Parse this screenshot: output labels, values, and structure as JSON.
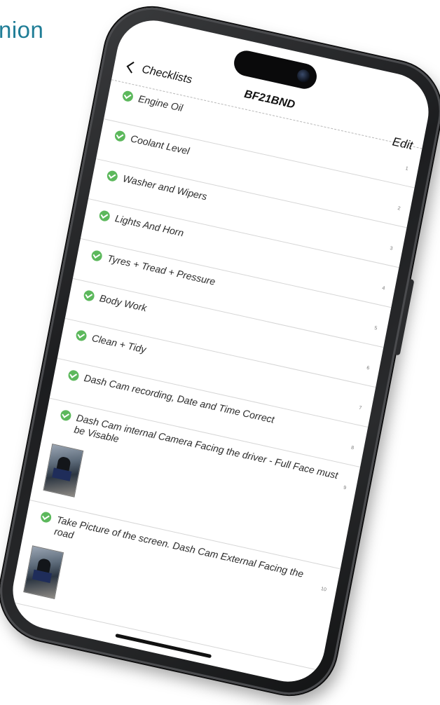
{
  "brand": {
    "fragment": "nion",
    "color": "#1f7d96"
  },
  "nav": {
    "back_label": "Checklists",
    "title": "BF21BND",
    "edit_label": "Edit"
  },
  "checklist": [
    {
      "label": "Engine Oil",
      "number": "1",
      "checked": true,
      "has_photo": false
    },
    {
      "label": "Coolant Level",
      "number": "2",
      "checked": true,
      "has_photo": false
    },
    {
      "label": "Washer and Wipers",
      "number": "3",
      "checked": true,
      "has_photo": false
    },
    {
      "label": "Lights And Horn",
      "number": "4",
      "checked": true,
      "has_photo": false
    },
    {
      "label": "Tyres + Tread + Pressure",
      "number": "5",
      "checked": true,
      "has_photo": false
    },
    {
      "label": "Body Work",
      "number": "6",
      "checked": true,
      "has_photo": false
    },
    {
      "label": "Clean + Tidy",
      "number": "7",
      "checked": true,
      "has_photo": false
    },
    {
      "label": "Dash Cam recording,  Date and Time Correct",
      "number": "8",
      "checked": true,
      "has_photo": false
    },
    {
      "label": "Dash Cam internal Camera Facing the driver - Full Face must be Visable",
      "number": "9",
      "checked": true,
      "has_photo": true
    },
    {
      "label": "Take Picture of the screen. Dash Cam External Facing the road",
      "number": "10",
      "checked": true,
      "has_photo": true
    }
  ],
  "colors": {
    "check": "#5cb85c",
    "frame": "#1c1d1f"
  }
}
